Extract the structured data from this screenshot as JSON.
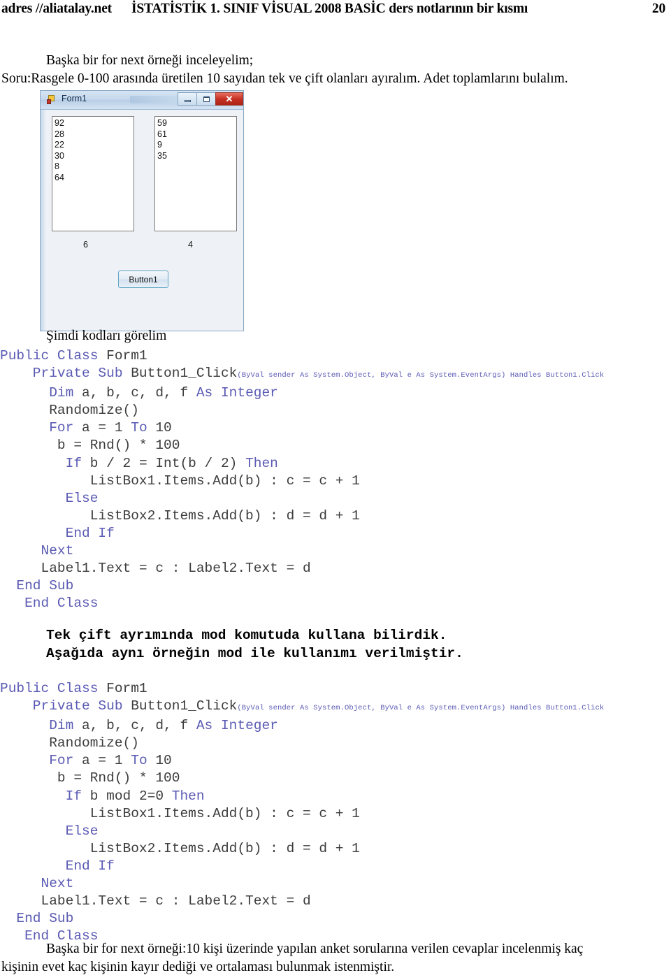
{
  "header": {
    "site": "adres //aliatalay.net",
    "title": "İSTATİSTİK 1. SINIF VİSUAL 2008 BASİC ders notlarının bir kısmı",
    "page_number": "20"
  },
  "intro": {
    "line1": "Başka bir for next örneği inceleyelim;",
    "line2": "Soru:Rasgele 0-100 arasında üretilen 10 sayıdan tek ve çift olanları ayıralım. Adet toplamlarını bulalım."
  },
  "form_window": {
    "title": "Form1",
    "icon": "form-icon",
    "minimize_label": "",
    "maximize_label": "",
    "close_label": "✕",
    "listbox1": [
      "92",
      "28",
      "22",
      "30",
      "8",
      "64"
    ],
    "listbox2": [
      "59",
      "61",
      "9",
      "35"
    ],
    "label1": "6",
    "label2": "4",
    "button1": "Button1"
  },
  "simdi_kodlari": "Şimdi kodları görelim",
  "code_signature": "(ByVal sender As System.Object, ByVal e As System.EventArgs) Handles Button1.Click",
  "code_block_1": {
    "l01_a": "Public Class ",
    "l01_b": "Form1",
    "l02_a": "    Private Sub ",
    "l02_b": "Button1_Click",
    "l03_a": "      Dim ",
    "l03_b": "a, b, c, d, f ",
    "l03_c": "As Integer",
    "l04": "      Randomize()",
    "l05_a": "      For ",
    "l05_b": "a = 1 ",
    "l05_c": "To",
    "l05_d": " 10",
    "l06": "       b = Rnd() * 100",
    "l07_a": "        If ",
    "l07_b": "b / 2 = Int(b / 2) ",
    "l07_c": "Then",
    "l08": "           ListBox1.Items.Add(b) : c = c + 1",
    "l09": "        Else",
    "l10": "           ListBox2.Items.Add(b) : d = d + 1",
    "l11": "        End If",
    "l12": "     Next",
    "l13": "     Label1.Text = c : Label2.Text = d",
    "l14": "  End Sub",
    "l15": "   End Class"
  },
  "note": {
    "line1": "Tek çift ayrımında mod komutuda kullana bilirdik.",
    "line2": "Aşağıda aynı örneğin mod ile kullanımı verilmiştir."
  },
  "code_block_2": {
    "l01_a": "Public Class ",
    "l01_b": "Form1",
    "l02_a": "    Private Sub ",
    "l02_b": "Button1_Click",
    "l03_a": "      Dim ",
    "l03_b": "a, b, c, d, f ",
    "l03_c": "As Integer",
    "l04": "      Randomize()",
    "l05_a": "      For ",
    "l05_b": "a = 1 ",
    "l05_c": "To",
    "l05_d": " 10",
    "l06": "       b = Rnd() * 100",
    "l07_a": "        If ",
    "l07_b": "b mod 2=0 ",
    "l07_c": "Then",
    "l08": "           ListBox1.Items.Add(b) : c = c + 1",
    "l09": "        Else",
    "l10": "           ListBox2.Items.Add(b) : d = d + 1",
    "l11": "        End If",
    "l12": "     Next",
    "l13": "     Label1.Text = c : Label2.Text = d",
    "l14": "  End Sub",
    "l15": "   End Class"
  },
  "outro": {
    "line1": "Başka bir for next örneği:10 kişi üzerinde yapılan anket sorularına verilen cevaplar incelenmiş kaç",
    "line2": "kişinin evet kaç kişinin kayır dediği ve ortalaması bulunmak istenmiştir."
  }
}
